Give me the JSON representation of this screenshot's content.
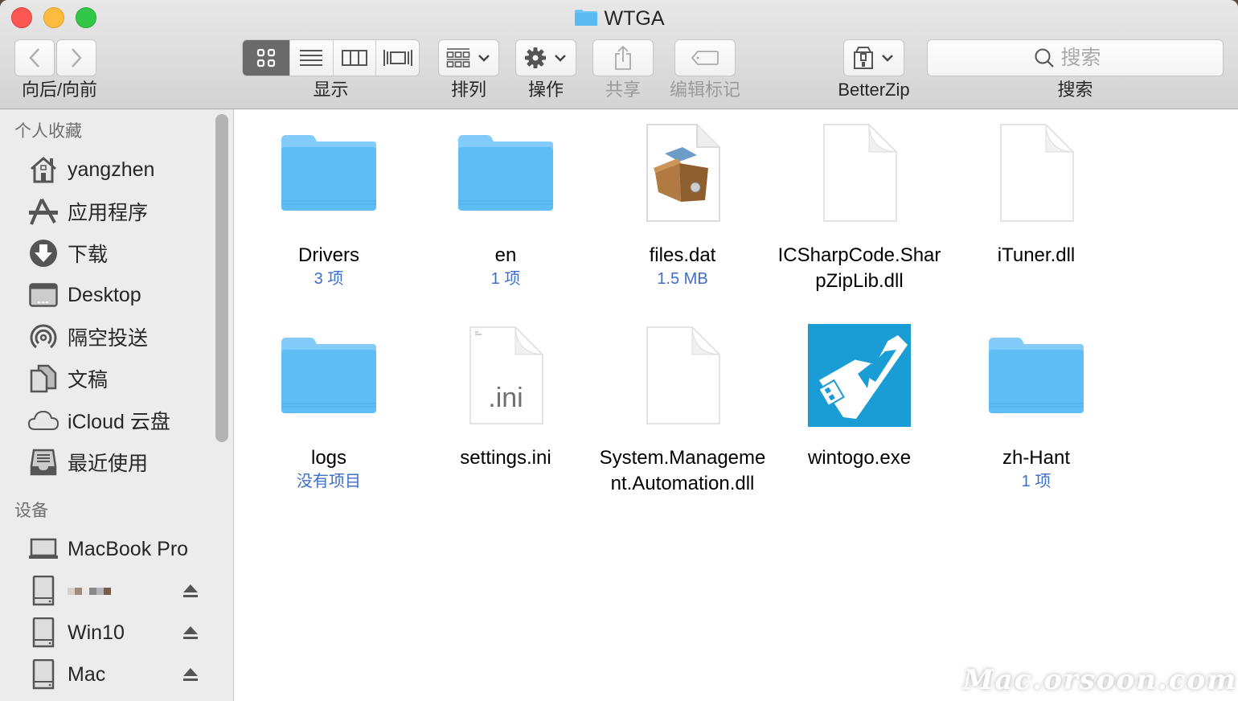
{
  "window": {
    "title": "WTGA",
    "title_icon": "folder-icon"
  },
  "toolbar": {
    "nav_label": "向后/向前",
    "back_icon": "chevron-left-icon",
    "forward_icon": "chevron-right-icon",
    "view_label": "显示",
    "view_modes": [
      {
        "name": "icon-view",
        "icon": "grid-icon",
        "selected": true
      },
      {
        "name": "list-view",
        "icon": "list-icon",
        "selected": false
      },
      {
        "name": "column-view",
        "icon": "columns-icon",
        "selected": false
      },
      {
        "name": "cover-flow-view",
        "icon": "coverflow-icon",
        "selected": false
      }
    ],
    "arrange_label": "排列",
    "action_label": "操作",
    "share_label": "共享",
    "tags_label": "编辑标记",
    "betterzip_label": "BetterZip",
    "search_label": "搜索",
    "search_placeholder": "搜索"
  },
  "sidebar": {
    "favorites_header": "个人收藏",
    "favorites": [
      {
        "label": "yangzhen",
        "icon": "home-icon"
      },
      {
        "label": "应用程序",
        "icon": "applications-icon"
      },
      {
        "label": "下载",
        "icon": "download-icon"
      },
      {
        "label": "Desktop",
        "icon": "desktop-icon"
      },
      {
        "label": "隔空投送",
        "icon": "airdrop-icon"
      },
      {
        "label": "文稿",
        "icon": "documents-icon"
      },
      {
        "label": "iCloud 云盘",
        "icon": "cloud-icon"
      },
      {
        "label": "最近使用",
        "icon": "recents-icon"
      }
    ],
    "devices_header": "设备",
    "devices": [
      {
        "label": "MacBook Pro",
        "icon": "laptop-icon",
        "ejectable": false
      },
      {
        "label": "",
        "icon": "drive-icon",
        "ejectable": true,
        "redacted": true
      },
      {
        "label": "Win10",
        "icon": "drive-icon",
        "ejectable": true
      },
      {
        "label": "Mac",
        "icon": "drive-icon",
        "ejectable": true
      }
    ]
  },
  "files": [
    {
      "name": "Drivers",
      "meta": "3 项",
      "type": "folder"
    },
    {
      "name": "en",
      "meta": "1 项",
      "type": "folder"
    },
    {
      "name": "files.dat",
      "meta": "1.5 MB",
      "type": "archive"
    },
    {
      "name": "ICSharpCode.SharpZipLib.dll",
      "meta": "",
      "type": "document"
    },
    {
      "name": "iTuner.dll",
      "meta": "",
      "type": "document"
    },
    {
      "name": "logs",
      "meta": "没有项目",
      "type": "folder"
    },
    {
      "name": "settings.ini",
      "meta": "",
      "type": "ini",
      "badge": ".ini"
    },
    {
      "name": "System.Management.Automation.dll",
      "meta": "",
      "type": "document"
    },
    {
      "name": "wintogo.exe",
      "meta": "",
      "type": "app"
    },
    {
      "name": "zh-Hant",
      "meta": "1 项",
      "type": "folder"
    }
  ],
  "colors": {
    "folder": "#5bbdf5",
    "meta_text": "#3d6fc8",
    "wintogo_bg": "#1a9cd4"
  },
  "watermark": "Mac.orsoon.com"
}
